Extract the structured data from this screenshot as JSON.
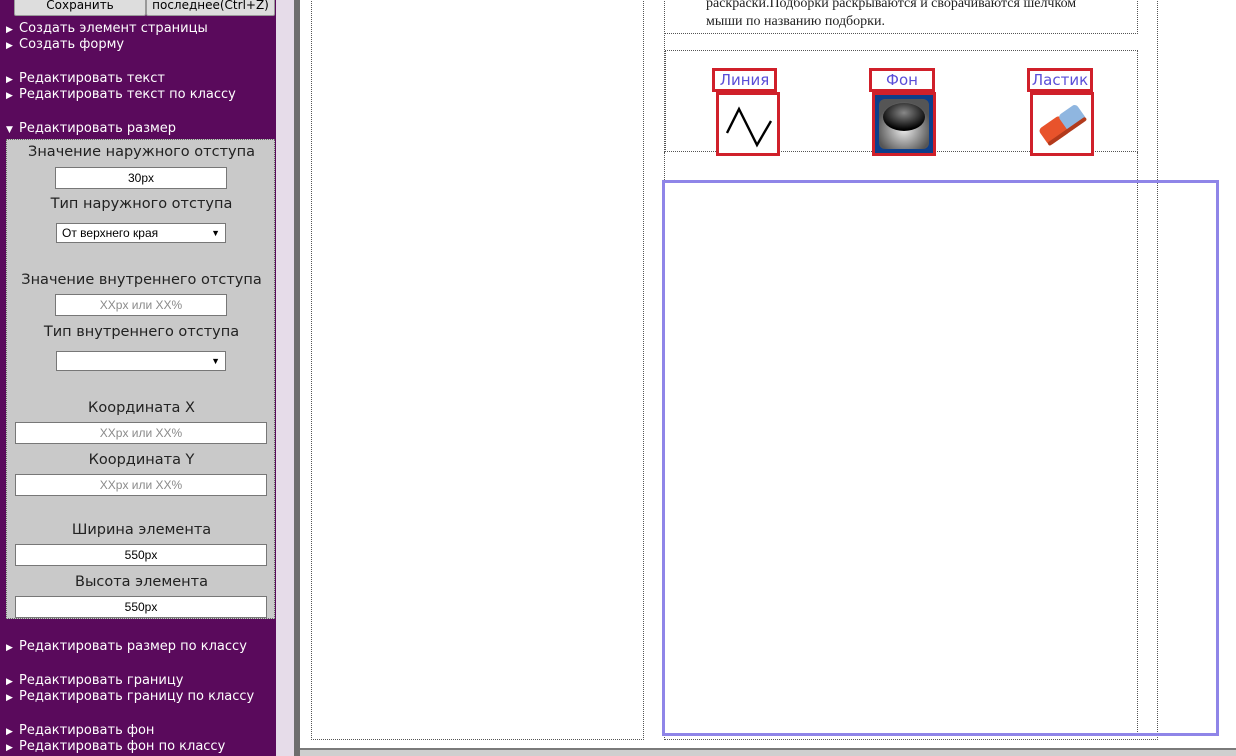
{
  "toolbar": {
    "save_label": "Сохранить",
    "undo_label": "последнее(Ctrl+Z)"
  },
  "menu": {
    "create_element": "Создать элемент страницы",
    "create_form": "Создать форму",
    "edit_text": "Редактировать текст",
    "edit_text_class": "Редактировать текст по классу",
    "edit_size": "Редактировать размер",
    "edit_size_class": "Редактировать размер по классу",
    "edit_border": "Редактировать границу",
    "edit_border_class": "Редактировать границу по классу",
    "edit_bg": "Редактировать фон",
    "edit_bg_class": "Редактировать фон по классу"
  },
  "props": {
    "margin_value_label": "Значение наружного отступа",
    "margin_value": "30px",
    "margin_type_label": "Тип наружного отступа",
    "margin_type_selected": "От верхнего края",
    "padding_value_label": "Значение внутреннего отступа",
    "padding_value_placeholder": "XXpx или XX%",
    "padding_type_label": "Тип внутреннего отступа",
    "padding_type_selected": "",
    "coord_x_label": "Координата X",
    "coord_x_placeholder": "XXpx или XX%",
    "coord_y_label": "Координата Y",
    "coord_y_placeholder": "XXpx или XX%",
    "width_label": "Ширина элемента",
    "width_value": "550px",
    "height_label": "Высота элемента",
    "height_value": "550px"
  },
  "canvas": {
    "description_line1": "раскраски.Подборки раскрываются и сворачиваются шелчком",
    "description_line2": "мыши по названию подборки.",
    "tools": [
      {
        "label": "Линия",
        "icon": "line-tool-icon"
      },
      {
        "label": "Фон",
        "icon": "fill-background-icon"
      },
      {
        "label": "Ластик",
        "icon": "eraser-icon"
      }
    ]
  },
  "colors": {
    "sidebar_bg": "#5a0a5c",
    "tool_border": "#d0202a",
    "tool_label": "#5a4ed8",
    "draw_area_border": "#8f85e8"
  }
}
